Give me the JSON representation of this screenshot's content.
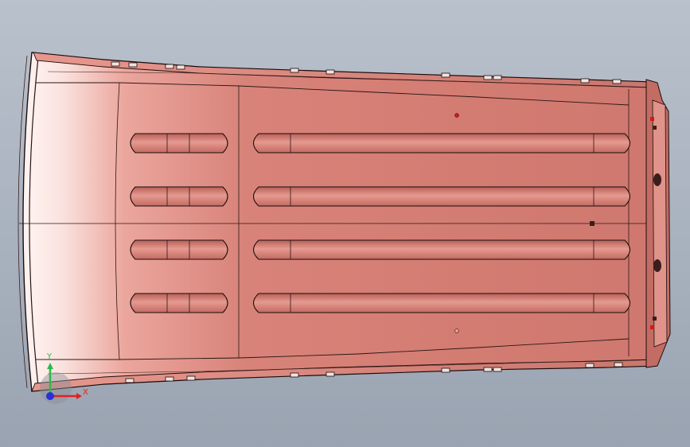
{
  "viewport": {
    "background_top": "#b9c1cc",
    "background_bottom": "#9aa3b1"
  },
  "part": {
    "body_color": "#d77c72",
    "highlight_color": "#fff4f2",
    "edge_color": "#1a0d0c",
    "marker_color": "#d11a1a"
  },
  "triad": {
    "x_label": "X",
    "y_label": "Y",
    "x_color": "#e0221e",
    "y_color": "#2eb84a",
    "z_color": "#2a2fd6"
  }
}
